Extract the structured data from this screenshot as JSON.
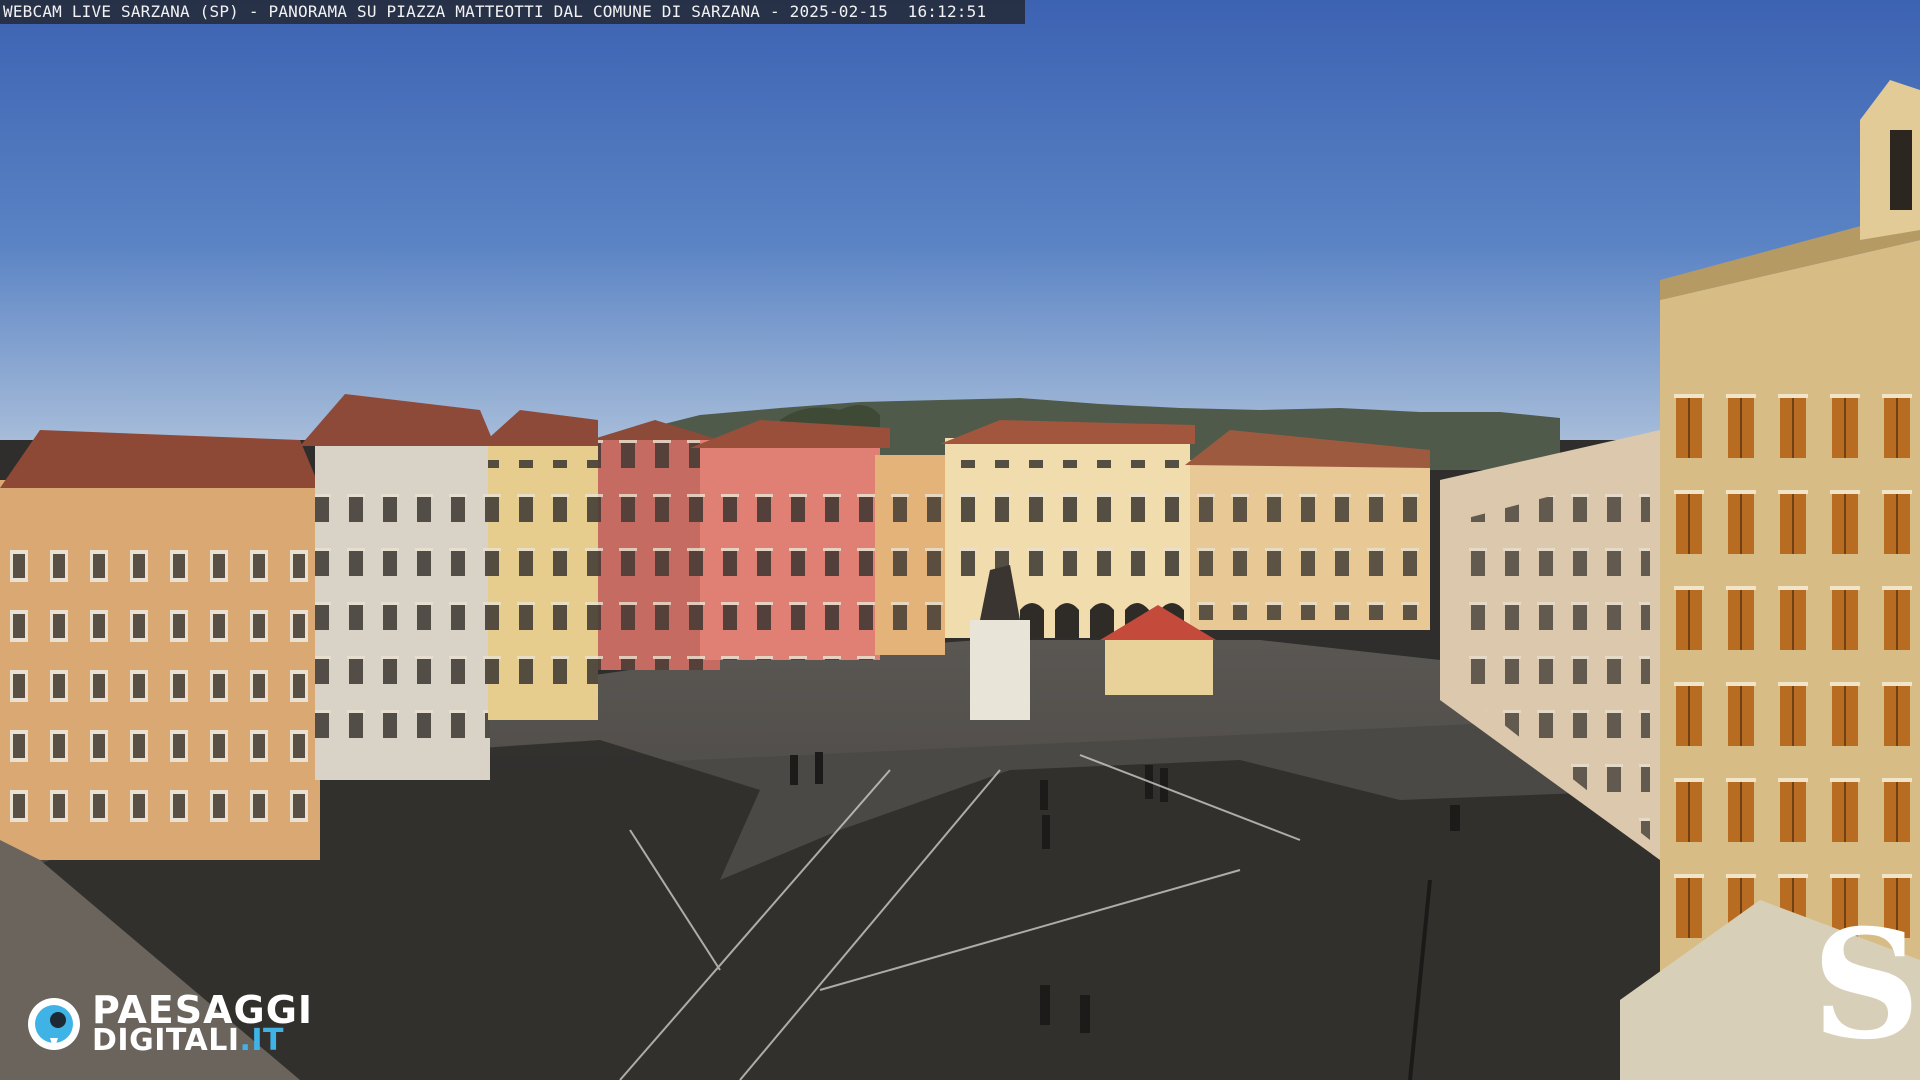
{
  "overlay": {
    "caption": "WEBCAM LIVE SARZANA (SP) - PANORAMA SU PIAZZA MATTEOTTI DAL COMUNE DI SARZANA - 2025-02-15  16:12:51"
  },
  "watermark": {
    "brand_line1": "PAESAGGI",
    "brand_line2": "DIGITALI",
    "brand_tld": ".IT",
    "corner_logo": "S"
  },
  "colors": {
    "sky_top": "#3b62b4",
    "sky_bottom": "#9fb6d6",
    "pavement": "#4a4845",
    "shadow": "#2c2b29",
    "brand_accent": "#3fb3e6"
  }
}
